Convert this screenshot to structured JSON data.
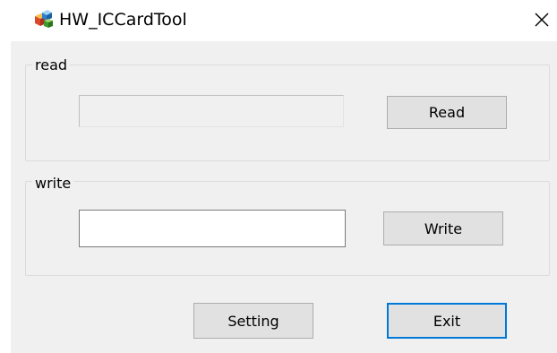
{
  "window": {
    "title": "HW_ICCardTool",
    "icon": "app-icon"
  },
  "read_group": {
    "label": "read",
    "value": "",
    "button_label": "Read"
  },
  "write_group": {
    "label": "write",
    "value": "",
    "button_label": "Write"
  },
  "footer": {
    "setting_label": "Setting",
    "exit_label": "Exit"
  },
  "colors": {
    "accent_border": "#0078d7",
    "button_face": "#e1e1e1",
    "client_bg": "#f0f0f0"
  }
}
